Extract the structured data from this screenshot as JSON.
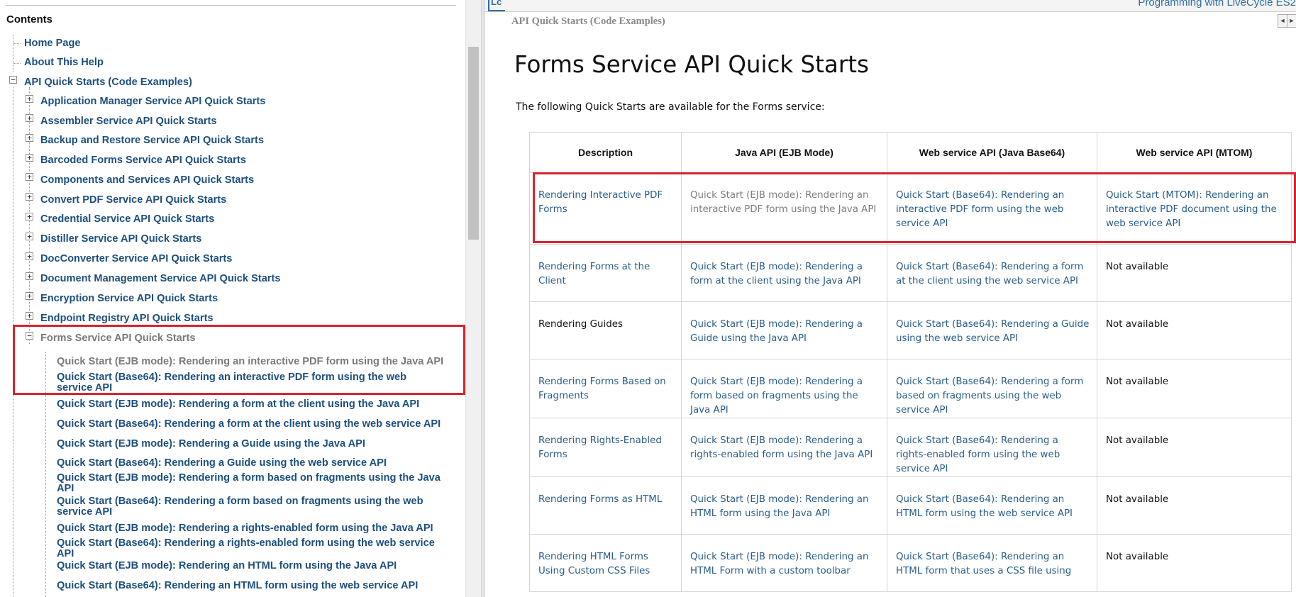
{
  "toc": {
    "title": "Contents",
    "top_items": [
      {
        "label": "Home Page"
      },
      {
        "label": "About This Help"
      }
    ],
    "root": {
      "label": "API Quick Starts (Code Examples)",
      "expand_symbol": "−"
    },
    "children": [
      {
        "label": "Application Manager Service API Quick Starts",
        "expand_symbol": "+"
      },
      {
        "label": "Assembler Service API Quick Starts",
        "expand_symbol": "+"
      },
      {
        "label": "Backup and Restore Service API Quick Starts",
        "expand_symbol": "+"
      },
      {
        "label": "Barcoded Forms Service API Quick Starts",
        "expand_symbol": "+"
      },
      {
        "label": "Components and Services API Quick Starts",
        "expand_symbol": "+"
      },
      {
        "label": "Convert PDF Service API Quick Starts",
        "expand_symbol": "+"
      },
      {
        "label": "Credential Service API Quick Starts",
        "expand_symbol": "+"
      },
      {
        "label": "Distiller Service API Quick Starts",
        "expand_symbol": "+"
      },
      {
        "label": "DocConverter Service API Quick Starts",
        "expand_symbol": "+"
      },
      {
        "label": "Document Management Service API Quick Starts",
        "expand_symbol": "+"
      },
      {
        "label": "Encryption Service API Quick Starts",
        "expand_symbol": "+"
      },
      {
        "label": "Endpoint Registry API Quick Starts",
        "expand_symbol": "+"
      },
      {
        "label": "Forms Service API Quick Starts",
        "expand_symbol": "−"
      }
    ],
    "forms_children": [
      {
        "label": "Quick Start (EJB mode): Rendering an interactive PDF form using the Java API"
      },
      {
        "label": "Quick Start (Base64): Rendering an interactive PDF form using the web service API"
      },
      {
        "label": "Quick Start (EJB mode): Rendering a form at the client using the Java API"
      },
      {
        "label": "Quick Start (Base64): Rendering a form at the client using the web service API"
      },
      {
        "label": "Quick Start (EJB mode): Rendering a Guide using the Java API"
      },
      {
        "label": "Quick Start (Base64): Rendering a Guide using the web service API"
      },
      {
        "label": "Quick Start (EJB mode): Rendering a form based on fragments using the Java API"
      },
      {
        "label": "Quick Start (Base64): Rendering a form based on fragments using the web service API"
      },
      {
        "label": "Quick Start (EJB mode): Rendering a rights-enabled form using the Java API"
      },
      {
        "label": "Quick Start (Base64): Rendering a rights-enabled form using the web service API"
      },
      {
        "label": "Quick Start (EJB mode): Rendering an HTML form using the Java API"
      },
      {
        "label": "Quick Start (Base64): Rendering an HTML form using the web service API"
      }
    ]
  },
  "header": {
    "logo": "Lc",
    "title": "Programming with LiveCycle ES2",
    "breadcrumb": "API Quick Starts (Code Examples)",
    "prev_symbol": "◄",
    "next_symbol": "►"
  },
  "main": {
    "heading": "Forms Service API Quick Starts",
    "intro": "The following Quick Starts are available for the Forms service:",
    "columns": [
      "Description",
      "Java API (EJB Mode)",
      "Web service API (Java Base64)",
      "Web service API (MTOM)"
    ],
    "rows": [
      {
        "description": "Rendering Interactive PDF Forms",
        "java": "Quick Start (EJB mode): Rendering an interactive PDF form using the Java API",
        "base64": "Quick Start (Base64): Rendering an interactive PDF form using the web service API",
        "mtom": "Quick Start (MTOM): Rendering an interactive PDF document using the web service API"
      },
      {
        "description": "Rendering Forms at the Client",
        "java": "Quick Start (EJB mode): Rendering a form at the client using the Java API",
        "base64": "Quick Start (Base64): Rendering a form at the client using the web service API",
        "mtom": "Not available"
      },
      {
        "description": "Rendering Guides",
        "java": "Quick Start (EJB mode): Rendering a Guide using the Java API",
        "base64": "Quick Start (Base64): Rendering a Guide using the web service API",
        "mtom": "Not available"
      },
      {
        "description": "Rendering Forms Based on Fragments",
        "java": "Quick Start (EJB mode): Rendering a form based on fragments using the Java API",
        "base64": "Quick Start (Base64): Rendering a form based on fragments using the web service API",
        "mtom": "Not available"
      },
      {
        "description": "Rendering Rights-Enabled Forms",
        "java": "Quick Start (EJB mode): Rendering a rights-enabled form using the Java API",
        "base64": "Quick Start (Base64): Rendering a rights-enabled form using the web service API",
        "mtom": "Not available"
      },
      {
        "description": "Rendering Forms as HTML",
        "java": "Quick Start (EJB mode): Rendering an HTML form using the Java API",
        "base64": "Quick Start (Base64): Rendering an HTML form using the web service API",
        "mtom": "Not available"
      },
      {
        "description": "Rendering HTML Forms Using Custom CSS Files",
        "java": "Quick Start (EJB mode): Rendering an HTML Form with a custom toolbar",
        "base64": "Quick Start (Base64): Rendering an HTML form that uses a CSS file using",
        "mtom": "Not available"
      }
    ]
  },
  "colors": {
    "link": "#1d4f7e",
    "visited": "#7a7a7a",
    "highlight": "#d8232f"
  }
}
